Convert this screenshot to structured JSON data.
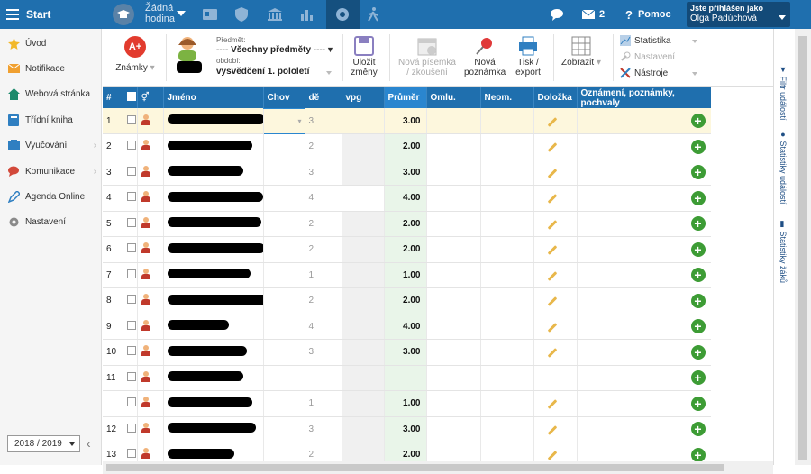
{
  "topbar": {
    "start": "Start",
    "hodina_line1": "Žádná",
    "hodina_line2": "hodina",
    "messages_count": "2",
    "help": "Pomoc",
    "user_label": "Jste přihlášen jako",
    "user_name": "Olga Padúchová"
  },
  "sidebar": {
    "items": [
      {
        "label": "Úvod",
        "icon": "star-icon"
      },
      {
        "label": "Notifikace",
        "icon": "envelope-icon"
      },
      {
        "label": "Webová stránka",
        "icon": "house-icon"
      },
      {
        "label": "Třídní kniha",
        "icon": "book-icon"
      },
      {
        "label": "Vyučování",
        "icon": "school-icon"
      },
      {
        "label": "Komunikace",
        "icon": "chat-icon"
      },
      {
        "label": "Agenda Online",
        "icon": "pencil-icon"
      },
      {
        "label": "Nastavení",
        "icon": "gear-icon"
      }
    ],
    "year": "2018 / 2019"
  },
  "toolbar": {
    "znamky": "Známky",
    "predmet_label": "Předmět:",
    "predmet_value": "---- Všechny předměty ----",
    "obdobi_label": "období:",
    "obdobi_value": "vysvědčení 1. pololetí",
    "ulozit1": "Uložit",
    "ulozit2": "změny",
    "pisemka1": "Nová písemka",
    "pisemka2": "/ zkoušení",
    "poznamka1": "Nová",
    "poznamka2": "poznámka",
    "tisk1": "Tisk /",
    "tisk2": "export",
    "zobrazit": "Zobrazit",
    "statistika": "Statistika",
    "nastaveni": "Nastavení",
    "nastroje": "Nástroje"
  },
  "table": {
    "headers": [
      "#",
      "",
      "",
      "Jméno",
      "Chov",
      "dě",
      "vpg",
      "Průměr",
      "Omlu.",
      "Neom.",
      "Doložka",
      "Oznámení, poznámky, pochvaly"
    ],
    "rows": [
      {
        "n": "1",
        "dej": "3",
        "avg": "3.00"
      },
      {
        "n": "2",
        "dej": "2",
        "avg": "2.00"
      },
      {
        "n": "3",
        "dej": "3",
        "avg": "3.00"
      },
      {
        "n": "4",
        "dej": "4",
        "avg": "4.00"
      },
      {
        "n": "5",
        "dej": "2",
        "avg": "2.00"
      },
      {
        "n": "6",
        "dej": "2",
        "avg": "2.00"
      },
      {
        "n": "7",
        "dej": "1",
        "avg": "1.00"
      },
      {
        "n": "8",
        "dej": "2",
        "avg": "2.00"
      },
      {
        "n": "9",
        "dej": "4",
        "avg": "4.00"
      },
      {
        "n": "10",
        "dej": "3",
        "avg": "3.00"
      },
      {
        "n": "11",
        "dej": "",
        "avg": ""
      },
      {
        "n": "",
        "dej": "1",
        "avg": "1.00"
      },
      {
        "n": "12",
        "dej": "3",
        "avg": "3.00"
      },
      {
        "n": "13",
        "dej": "2",
        "avg": "2.00"
      }
    ]
  },
  "rightpanel": {
    "filtr": "Filtr událostí",
    "stat_udalosti": "Statistiky událostí",
    "stat_zaku": "Statistiky žáků"
  },
  "colors": {
    "topbar": "#1f6fae",
    "accent": "#2a86cf",
    "add": "#3d9c35"
  }
}
